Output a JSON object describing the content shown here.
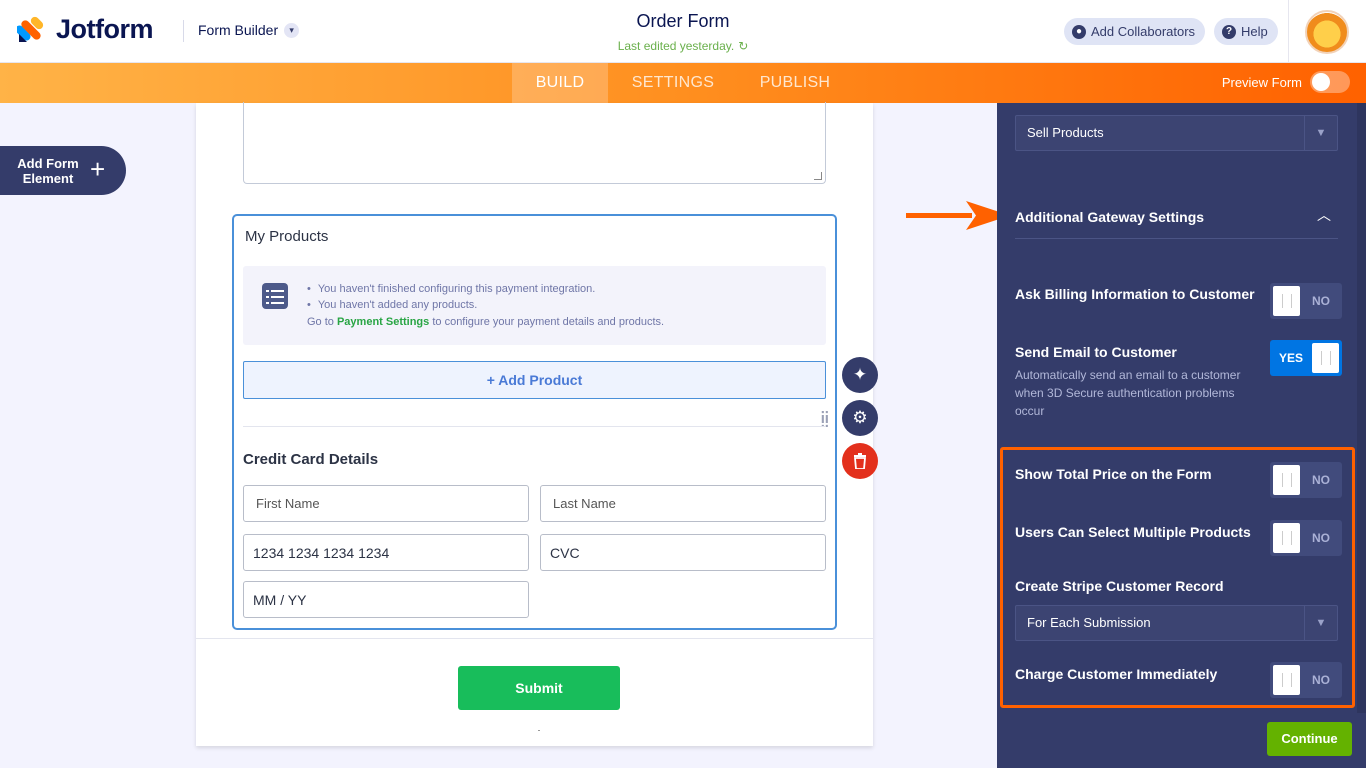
{
  "header": {
    "brand": "Jotform",
    "builder_label": "Form Builder",
    "form_title": "Order Form",
    "last_edited": "Last edited yesterday.",
    "collaborators_label": "Add Collaborators",
    "help_label": "Help"
  },
  "nav": {
    "tabs": [
      "BUILD",
      "SETTINGS",
      "PUBLISH"
    ],
    "active_tab": "BUILD",
    "preview_label": "Preview Form"
  },
  "left": {
    "add_element_label": "Add Form Element"
  },
  "form": {
    "products_title": "My Products",
    "notices": [
      "You haven't finished configuring this payment integration.",
      "You haven't added any products."
    ],
    "goto_prefix": "Go to",
    "goto_link": "Payment Settings",
    "goto_suffix": "to configure your payment details and products.",
    "add_product_label": "+ Add Product",
    "cc_title": "Credit Card Details",
    "first_name_placeholder": "First Name",
    "last_name_placeholder": "Last Name",
    "card_number_placeholder": "1234 1234 1234 1234",
    "cvc_placeholder": "CVC",
    "expiry_placeholder": "MM / YY",
    "submit_label": "Submit"
  },
  "panel": {
    "payment_type_value": "Sell Products",
    "section_title": "Additional Gateway Settings",
    "settings": [
      {
        "label": "Ask Billing Information to Customer",
        "state": "NO"
      },
      {
        "label": "Send Email to Customer",
        "state": "YES",
        "description": "Automatically send an email to a customer when 3D Secure authentication problems occur"
      },
      {
        "label": "Show Total Price on the Form",
        "state": "NO"
      },
      {
        "label": "Users Can Select Multiple Products",
        "state": "NO"
      },
      {
        "label": "Create Stripe Customer Record",
        "value": "For Each Submission"
      },
      {
        "label": "Charge Customer Immediately",
        "state": "NO"
      }
    ],
    "continue_label": "Continue"
  },
  "colors": {
    "brand_orange": "#ff6100",
    "panel_bg": "#343c6a",
    "submit_green": "#18bd5b",
    "continue_green": "#64b200",
    "toggle_on": "#0075e3"
  }
}
